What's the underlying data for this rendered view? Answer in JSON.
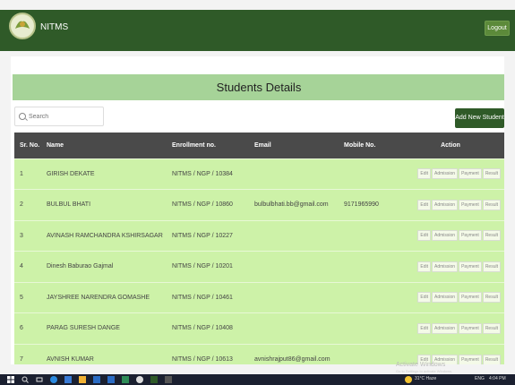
{
  "app": {
    "brand": "NITMS",
    "logout_label": "Logout"
  },
  "page": {
    "title": "Students Details"
  },
  "search": {
    "placeholder": "Search",
    "value": ""
  },
  "add_button_label": "Add New Student",
  "table": {
    "headers": [
      "Sr. No.",
      "Name",
      "Enrollment no.",
      "Email",
      "Mobile No.",
      "Action"
    ],
    "action_labels": [
      "Edit",
      "Admission",
      "Payment",
      "Result"
    ],
    "rows": [
      {
        "sr": "1",
        "name": "GIRISH DEKATE",
        "enrollment": "NITMS / NGP / 10384",
        "email": "",
        "mobile": ""
      },
      {
        "sr": "2",
        "name": "BULBUL BHATI",
        "enrollment": "NITMS / NGP / 10860",
        "email": "bulbulbhati.bb@gmail.com",
        "mobile": "9171965990"
      },
      {
        "sr": "3",
        "name": "AVINASH RAMCHANDRA KSHIRSAGAR",
        "enrollment": "NITMS / NGP / 10227",
        "email": "",
        "mobile": ""
      },
      {
        "sr": "4",
        "name": "Dinesh Baburao Gajmal",
        "enrollment": "NITMS / NGP / 10201",
        "email": "",
        "mobile": ""
      },
      {
        "sr": "5",
        "name": "JAYSHREE NARENDRA GOMASHE",
        "enrollment": "NITMS / NGP / 10461",
        "email": "",
        "mobile": ""
      },
      {
        "sr": "6",
        "name": "PARAG SURESH DANGE",
        "enrollment": "NITMS / NGP / 10408",
        "email": "",
        "mobile": ""
      },
      {
        "sr": "7",
        "name": "AVNISH KUMAR",
        "enrollment": "NITMS / NGP / 10613",
        "email": "avnishrajput86@gmail.com",
        "mobile": ""
      }
    ]
  },
  "watermark": {
    "line1": "Activate Windows",
    "line2": "Go to Settings to activate Windows."
  },
  "taskbar": {
    "weather": "31°C Haze",
    "lang": "ENG",
    "time": "4:04 PM"
  },
  "colors": {
    "navbar": "#2f5a28",
    "title_bar": "#a6d398",
    "row_bg": "#cdf2a8",
    "header_bg": "#4a4a4a"
  }
}
